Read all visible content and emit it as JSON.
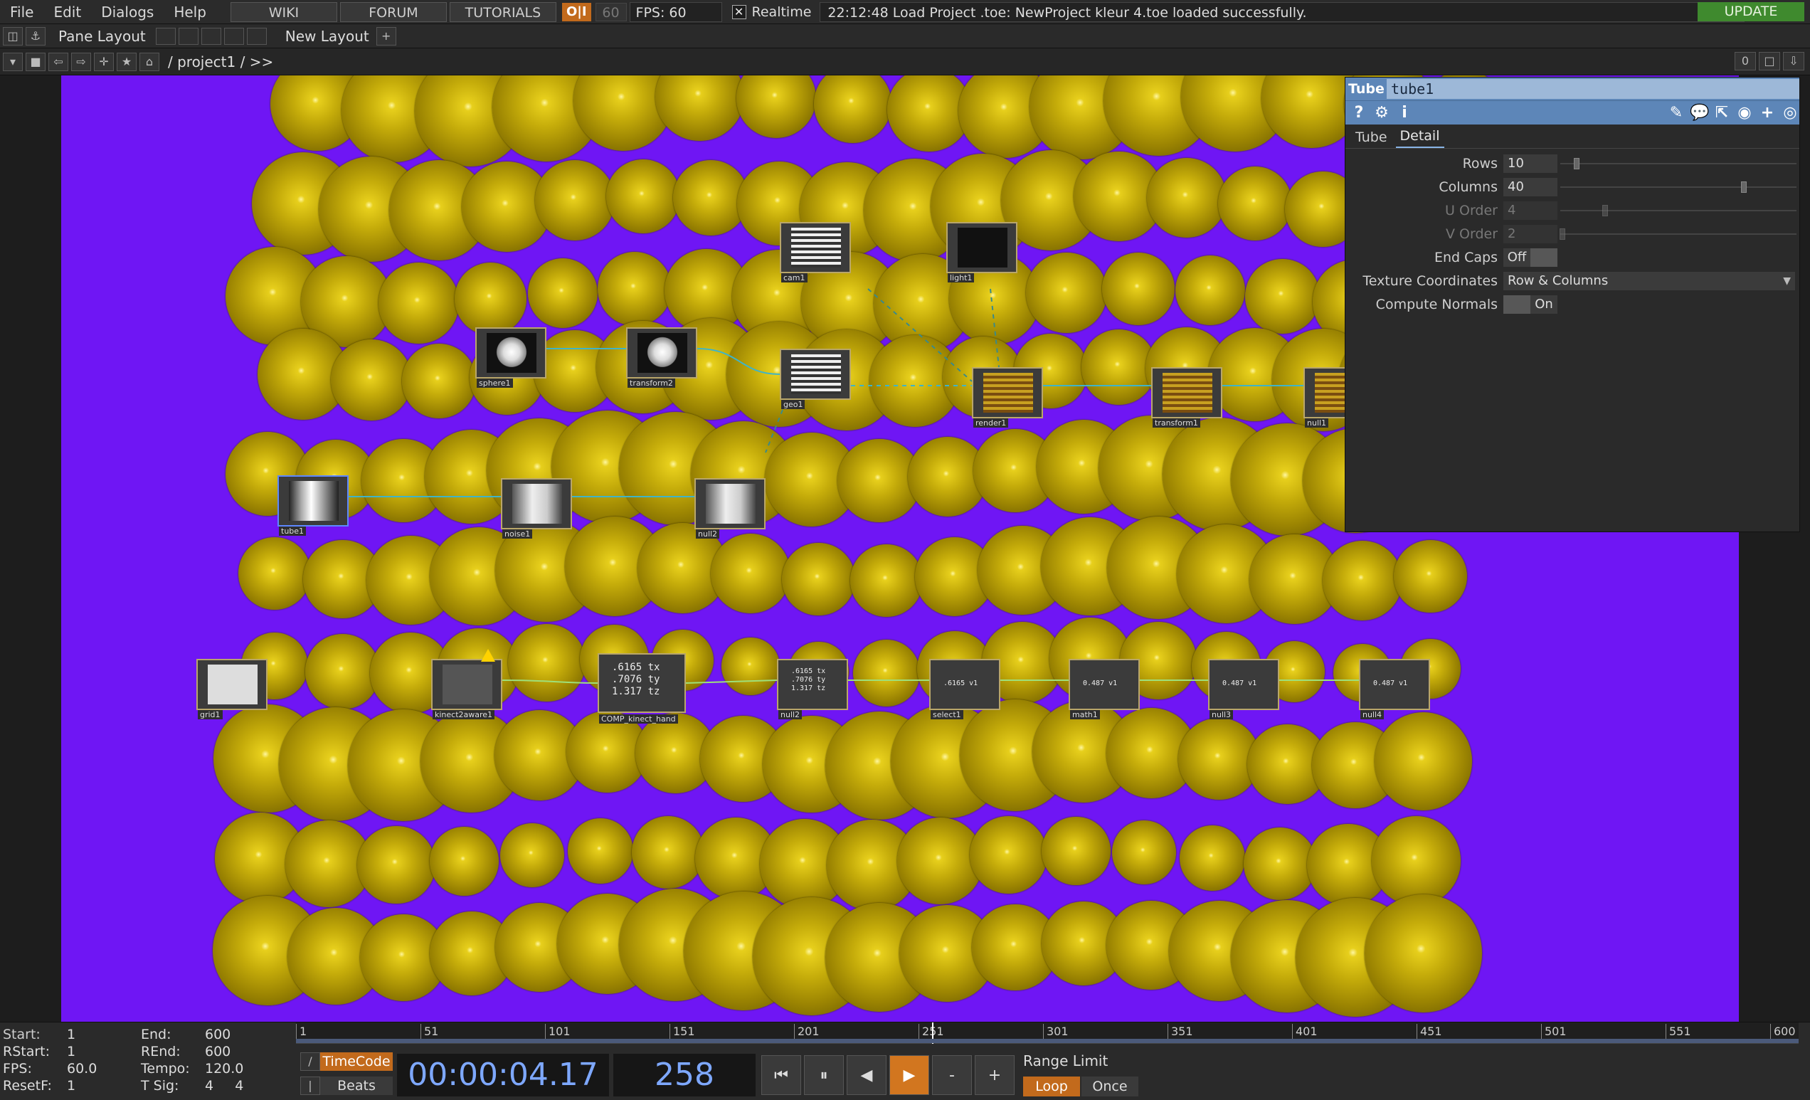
{
  "menubar": {
    "items": [
      "File",
      "Edit",
      "Dialogs",
      "Help"
    ],
    "links": [
      "WIKI",
      "FORUM",
      "TUTORIALS"
    ],
    "oi_label": "O|I",
    "fps_cap": "60",
    "fps_readout": "FPS:  60",
    "realtime_check": "✕",
    "realtime_label": "Realtime",
    "status": "22:12:48 Load Project .toe: NewProject kleur 4.toe loaded successfully.",
    "update_label": "UPDATE"
  },
  "panebar": {
    "pane_layout_label": "Pane Layout",
    "new_layout_label": "New Layout",
    "add_label": "+"
  },
  "pathbar": {
    "path": "/ project1 / >>",
    "count": "0"
  },
  "network": {
    "operators": [
      {
        "label": "cam1"
      },
      {
        "label": "light1"
      },
      {
        "label": "sphere1"
      },
      {
        "label": "transform2"
      },
      {
        "label": "geo1"
      },
      {
        "label": "render1"
      },
      {
        "label": "transform1"
      },
      {
        "label": "null1"
      },
      {
        "label": "tube1"
      },
      {
        "label": "noise1"
      },
      {
        "label": "null2"
      },
      {
        "label": "grid1"
      },
      {
        "label": "kinect2aware1"
      },
      {
        "label": "COMP_kinect_hand",
        "values": [
          ".6165 tx",
          ".7076 ty",
          "1.317 tz"
        ]
      },
      {
        "label": "null2",
        "values": [
          ".6165 tx",
          ".7076 ty",
          "1.317 tz"
        ]
      },
      {
        "label": "select1",
        "values": [
          ".6165 v1"
        ]
      },
      {
        "label": "math1",
        "values": [
          "0.487 v1"
        ]
      },
      {
        "label": "null3",
        "values": [
          "0.487 v1"
        ]
      },
      {
        "label": "null4",
        "values": [
          "0.487 v1"
        ]
      }
    ]
  },
  "params": {
    "op_type": "Tube",
    "op_name": "tube1",
    "toolbar_icons": [
      "help-icon",
      "python-help-icon",
      "info-icon",
      "edit-icon",
      "comment-icon",
      "export-icon",
      "python-icon",
      "add-icon",
      "target-icon"
    ],
    "help_glyph": "?",
    "info_glyph": "i",
    "tabs": [
      "Tube",
      "Detail"
    ],
    "active_tab": "Detail",
    "rows_label": "Rows",
    "rows_value": "10",
    "rows_fraction": 0.08,
    "columns_label": "Columns",
    "columns_value": "40",
    "columns_fraction": 0.78,
    "uorder_label": "U Order",
    "uorder_value": "4",
    "uorder_fraction": 0.2,
    "vorder_label": "V Order",
    "vorder_value": "2",
    "vorder_fraction": 0.02,
    "endcaps_label": "End Caps",
    "endcaps_value": "Off",
    "texcoords_label": "Texture Coordinates",
    "texcoords_value": "Row & Columns",
    "normals_label": "Compute Normals",
    "normals_value": "On"
  },
  "timeline": {
    "start_k": "Start:",
    "start_v": "1",
    "end_k": "End:",
    "end_v": "600",
    "rstart_k": "RStart:",
    "rstart_v": "1",
    "rend_k": "REnd:",
    "rend_v": "600",
    "fps_k": "FPS:",
    "fps_v": "60.0",
    "tempo_k": "Tempo:",
    "tempo_v": "120.0",
    "resetf_k": "ResetF:",
    "resetf_v": "1",
    "tsig_k": "T Sig:",
    "tsig_v": "4     4",
    "ticks": [
      "1",
      "51",
      "101",
      "151",
      "201",
      "251",
      "301",
      "351",
      "401",
      "451",
      "501",
      "551",
      "600"
    ],
    "timecode_label": "TimeCode",
    "beats_label": "Beats",
    "timecode": "00:00:04.17",
    "frame": "258",
    "range_limit_label": "Range Limit",
    "loop_label": "Loop",
    "once_label": "Once",
    "minus_label": "-",
    "plus_label": "+"
  }
}
